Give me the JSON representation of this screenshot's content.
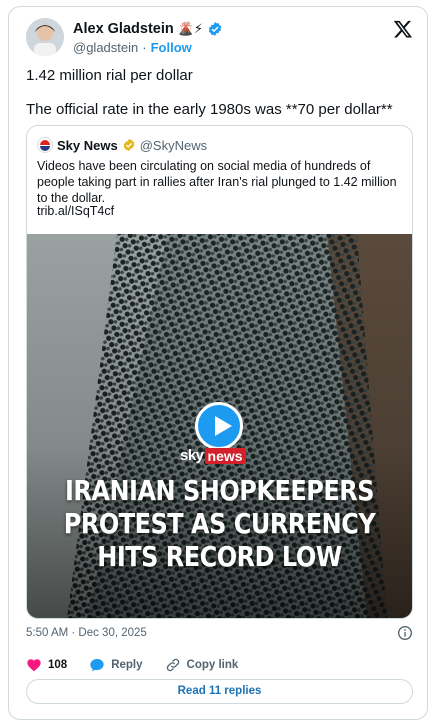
{
  "author": {
    "name": "Alex Gladstein",
    "emoji": "🌋⚡",
    "handle": "@gladstein",
    "separator": "·",
    "follow_label": "Follow"
  },
  "tweet": {
    "line1": "1.42 million rial per dollar",
    "line2": "The official rate in the early 1980s was **70 per dollar**"
  },
  "quoted": {
    "name": "Sky News",
    "handle": "@SkyNews",
    "text": "Videos have been circulating on social media of hundreds of people taking part in rallies after Iran's rial plunged to 1.42 million to the dollar.",
    "link": "trib.al/ISqT4cf",
    "media": {
      "brand_word": "sky",
      "brand_tag": "news",
      "headline": [
        "IRANIAN SHOPKEEPERS",
        "PROTEST AS CURRENCY",
        "HITS RECORD LOW"
      ]
    }
  },
  "footer": {
    "timestamp": "5:50 AM · Dec 30, 2025",
    "likes": "108",
    "reply_label": "Reply",
    "copy_label": "Copy link",
    "read_replies": "Read 11 replies"
  },
  "colors": {
    "accent": "#1d9bf0",
    "like": "#f91880",
    "sky_red": "#d4202a"
  },
  "icons": [
    "x-logo-icon",
    "verified-icon",
    "gold-badge-icon",
    "play-icon",
    "info-icon",
    "heart-icon",
    "reply-icon",
    "link-icon"
  ]
}
